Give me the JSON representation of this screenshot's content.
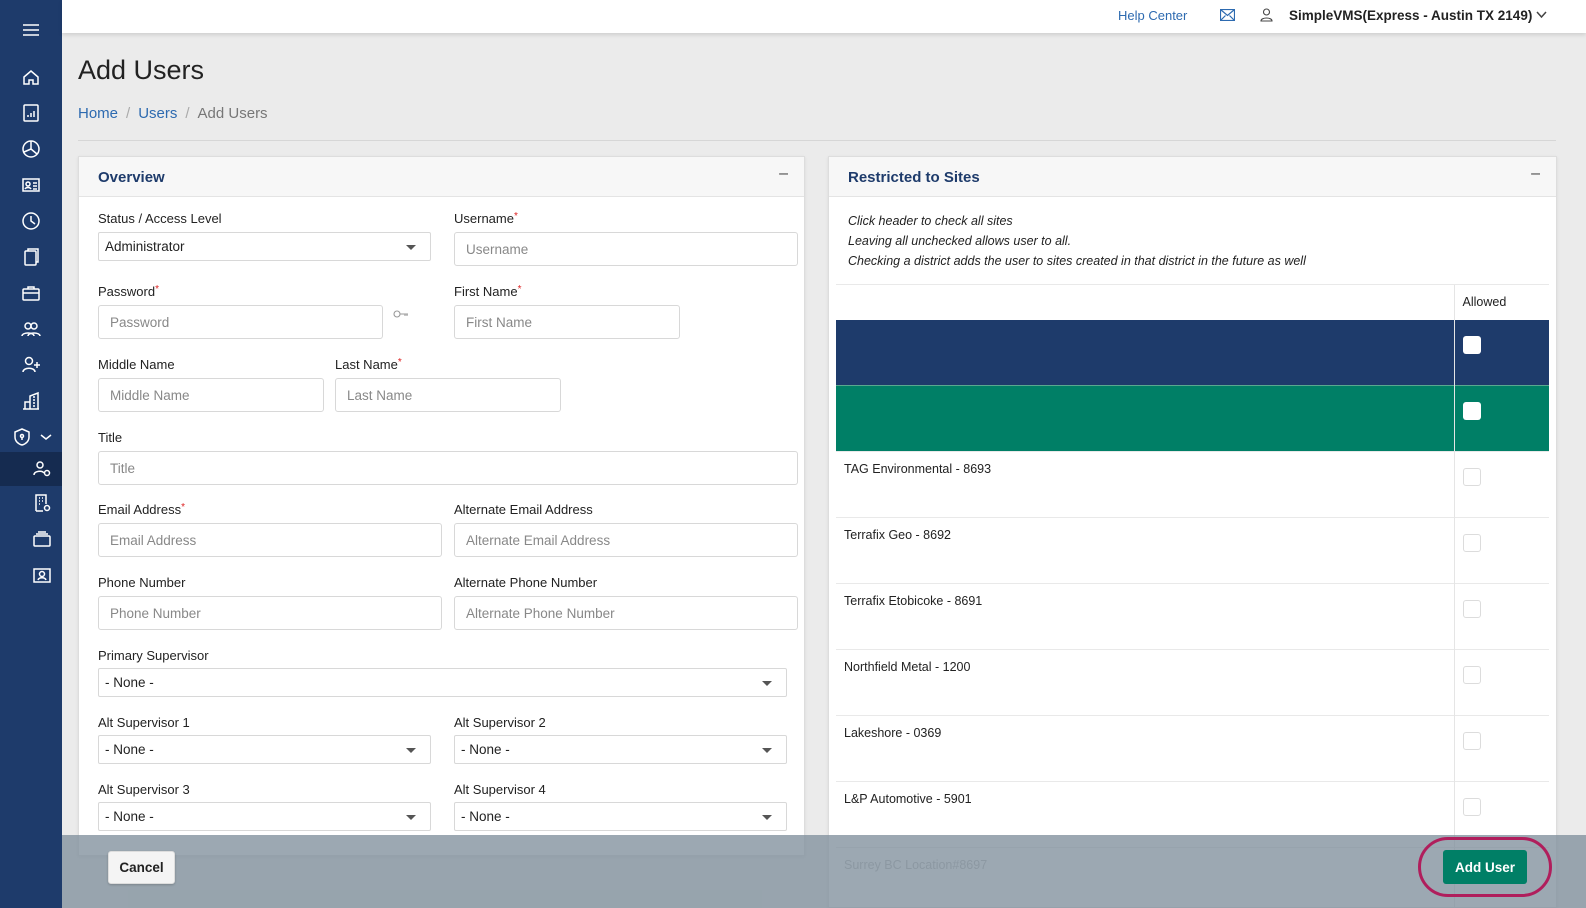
{
  "sidebar": {
    "items": [
      {
        "icon": "menu-icon"
      },
      {
        "icon": "home-icon"
      },
      {
        "icon": "report-chart-icon"
      },
      {
        "icon": "pie-chart-icon"
      },
      {
        "icon": "id-card-icon"
      },
      {
        "icon": "clock-icon"
      },
      {
        "icon": "documents-icon"
      },
      {
        "icon": "briefcase-icon"
      },
      {
        "icon": "users-group-icon"
      },
      {
        "icon": "add-user-icon"
      },
      {
        "icon": "buildings-icon"
      },
      {
        "icon": "shield-icon",
        "expanded": true
      },
      {
        "icon": "user-settings-icon",
        "active": true
      },
      {
        "icon": "building-settings-icon"
      },
      {
        "icon": "card-stack-icon"
      },
      {
        "icon": "badge-icon"
      }
    ]
  },
  "topbar": {
    "help_label": "Help Center",
    "mail_icon": "mail-icon",
    "user_icon": "user-icon",
    "org_name": "SimpleVMS(Express - Austin TX 2149)"
  },
  "page": {
    "title": "Add Users",
    "breadcrumb": [
      "Home",
      "Users",
      "Add Users"
    ]
  },
  "overview": {
    "title": "Overview",
    "collapse": "–",
    "fields": {
      "status": {
        "label": "Status / Access Level",
        "value": "Administrator"
      },
      "username": {
        "label": "Username",
        "required": "*",
        "placeholder": "Username"
      },
      "password": {
        "label": "Password",
        "required": "*",
        "placeholder": "Password"
      },
      "first_name": {
        "label": "First Name",
        "required": "*",
        "placeholder": "First Name"
      },
      "middle_name": {
        "label": "Middle Name",
        "placeholder": "Middle Name"
      },
      "last_name": {
        "label": "Last Name",
        "required": "*",
        "placeholder": "Last Name"
      },
      "title": {
        "label": "Title",
        "placeholder": "Title"
      },
      "email": {
        "label": "Email Address",
        "required": "*",
        "placeholder": "Email Address"
      },
      "alt_email": {
        "label": "Alternate Email Address",
        "placeholder": "Alternate Email Address"
      },
      "phone": {
        "label": "Phone Number",
        "placeholder": "Phone Number"
      },
      "alt_phone": {
        "label": "Alternate Phone Number",
        "placeholder": "Alternate Phone Number"
      },
      "primary_supervisor": {
        "label": "Primary Supervisor",
        "value": "- None -"
      },
      "alt_supervisor_1": {
        "label": "Alt Supervisor 1",
        "value": "- None -"
      },
      "alt_supervisor_2": {
        "label": "Alt Supervisor 2",
        "value": "- None -"
      },
      "alt_supervisor_3": {
        "label": "Alt Supervisor 3",
        "value": "- None -"
      },
      "alt_supervisor_4": {
        "label": "Alt Supervisor 4",
        "value": "- None -"
      }
    }
  },
  "sites": {
    "title": "Restricted to Sites",
    "collapse": "–",
    "notes": [
      "Click header to check all sites",
      "Leaving all unchecked allows user to all.",
      "Checking a district adds the user to sites created in that district in the future as well"
    ],
    "column_allowed": "Allowed",
    "colors": {
      "district": "#1e3b6b",
      "group": "#007f66"
    },
    "rows": [
      {
        "name": "",
        "type": "district",
        "checked": false
      },
      {
        "name": "",
        "type": "group",
        "checked": false
      },
      {
        "name": "TAG Environmental - 8693",
        "checked": false
      },
      {
        "name": "Terrafix Geo - 8692",
        "checked": false
      },
      {
        "name": "Terrafix Etobicoke - 8691",
        "checked": false
      },
      {
        "name": "Northfield Metal - 1200",
        "checked": false
      },
      {
        "name": "Lakeshore - 0369",
        "checked": false
      },
      {
        "name": "L&P Automotive - 5901",
        "checked": false
      },
      {
        "name": "Surrey BC Location#8697",
        "checked": false
      }
    ]
  },
  "actions": {
    "cancel": "Cancel",
    "add_user": "Add User",
    "highlight_color": "#b01e5c",
    "primary_color": "#007f66"
  }
}
